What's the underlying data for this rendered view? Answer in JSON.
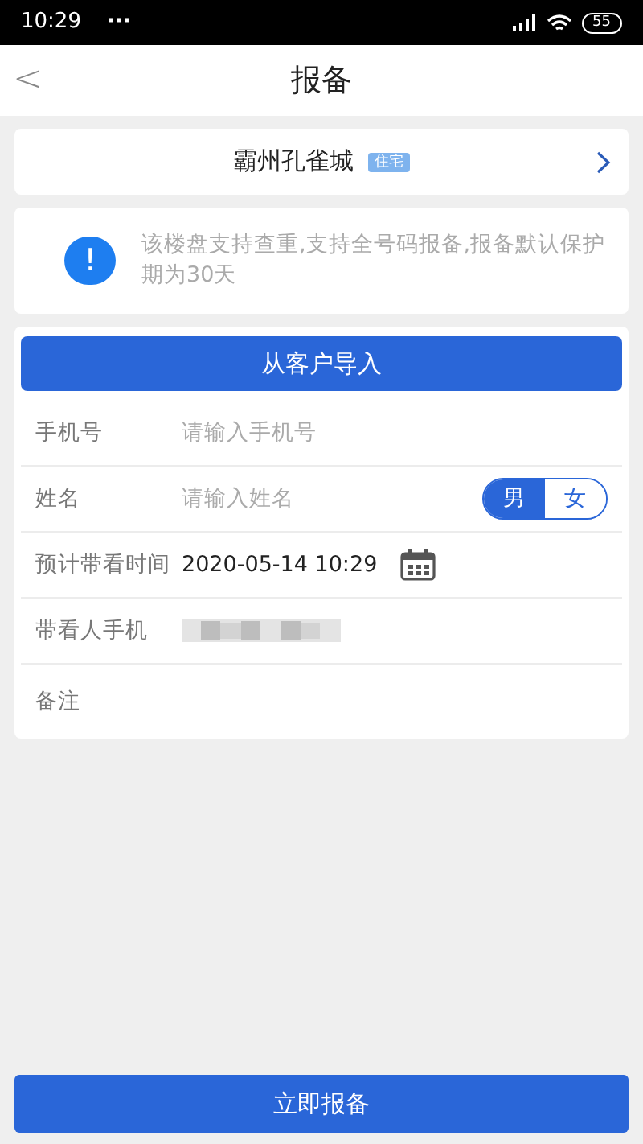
{
  "status_bar": {
    "time": "10:29",
    "dots": "···",
    "battery": "55"
  },
  "header": {
    "back": "<",
    "title": "报备"
  },
  "project": {
    "name": "霸州孔雀城",
    "tag": "住宅"
  },
  "notice": {
    "icon": "!",
    "text": "该楼盘支持查重,支持全号码报备,报备默认保护期为30天"
  },
  "import_button": "从客户导入",
  "fields": [
    {
      "kind": "input",
      "label": "手机号",
      "placeholder": "请输入手机号"
    },
    {
      "kind": "input",
      "label": "姓名",
      "placeholder": "请输入姓名",
      "gender": [
        {
          "label": "男",
          "selected": true
        },
        {
          "label": "女",
          "selected": false
        }
      ]
    },
    {
      "kind": "datetime",
      "label": "预计带看时间",
      "value": "2020-05-14 10:29"
    },
    {
      "kind": "masked",
      "label": "带看人手机"
    },
    {
      "kind": "note",
      "label": "备注"
    }
  ],
  "submit_button": "立即报备"
}
